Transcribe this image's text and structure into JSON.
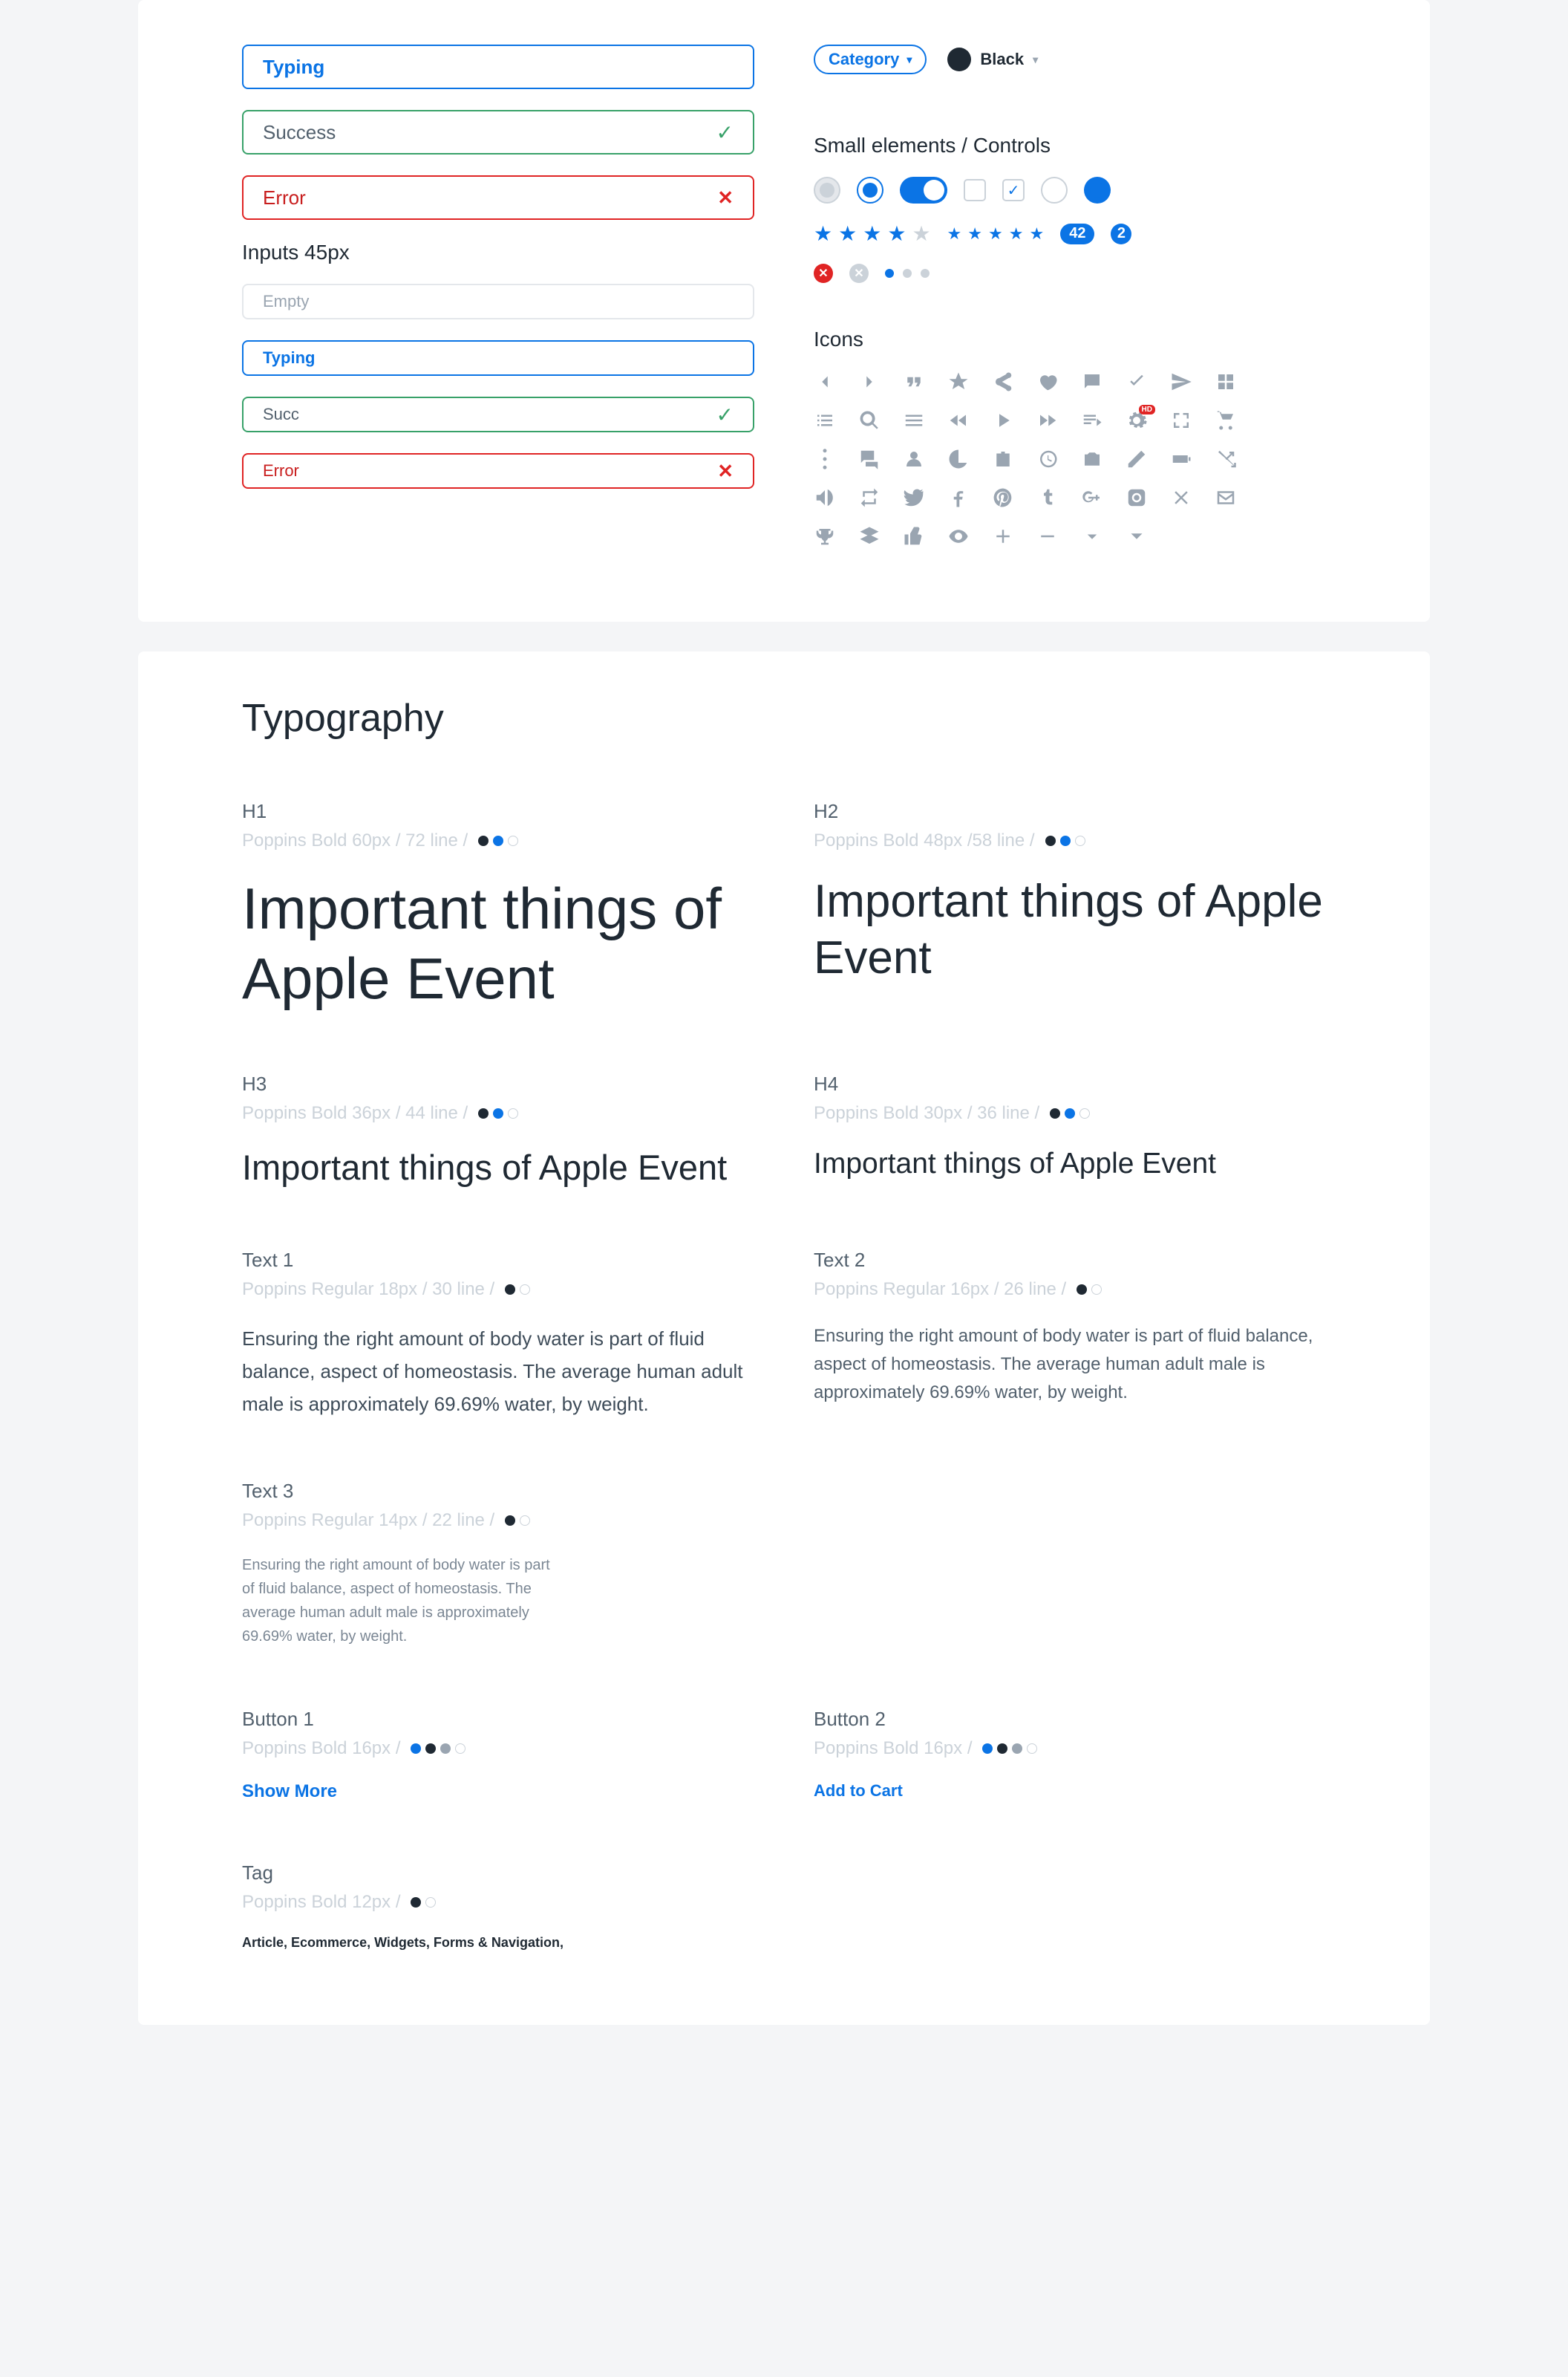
{
  "inputs": {
    "typing": "Typing",
    "success": "Success",
    "error": "Error",
    "smallLabel": "Inputs 45px",
    "empty": "Empty",
    "smallTyping": "Typing",
    "smallSuccess": "Succ",
    "smallError": "Error"
  },
  "chip": {
    "label": "Category"
  },
  "colorTag": {
    "label": "Black"
  },
  "controlsTitle": "Small elements / Controls",
  "badges": {
    "count": "42",
    "single": "2",
    "hd": "HD"
  },
  "iconsTitle": "Icons",
  "typo": {
    "title": "Typography",
    "h1": {
      "label": "H1",
      "meta": "Poppins Bold 60px / 72 line /",
      "sample": "Important things of Apple Event"
    },
    "h2": {
      "label": "H2",
      "meta": "Poppins Bold 48px /58 line /",
      "sample": "Important things of Apple Event"
    },
    "h3": {
      "label": "H3",
      "meta": "Poppins Bold 36px / 44 line /",
      "sample": "Important things of Apple Event"
    },
    "h4": {
      "label": "H4",
      "meta": "Poppins Bold 30px / 36 line /",
      "sample": "Important things of Apple Event"
    },
    "text1": {
      "label": "Text 1",
      "meta": "Poppins Regular 18px / 30 line /",
      "sample": "Ensuring the right amount of body water is part of fluid balance, aspect of homeostasis. The average human adult male is approximately 69.69% water, by weight."
    },
    "text2": {
      "label": "Text 2",
      "meta": "Poppins Regular 16px / 26 line /",
      "sample": "Ensuring the right amount of body water is part of fluid balance, aspect of homeostasis. The average human adult male is approximately 69.69% water, by weight."
    },
    "text3": {
      "label": "Text 3",
      "meta": "Poppins Regular 14px / 22 line /",
      "sample": "Ensuring the right amount of body water is part of fluid balance, aspect of homeostasis. The average human adult male is approximately 69.69% water, by weight."
    },
    "btn1": {
      "label": "Button 1",
      "meta": "Poppins Bold 16px /",
      "sample": "Show More"
    },
    "btn2": {
      "label": "Button 2",
      "meta": "Poppins Bold 16px /",
      "sample": "Add to Cart"
    },
    "tag": {
      "label": "Tag",
      "meta": "Poppins Bold 12px /",
      "sample": "Article, Ecommerce, Widgets, Forms & Navigation,"
    }
  }
}
